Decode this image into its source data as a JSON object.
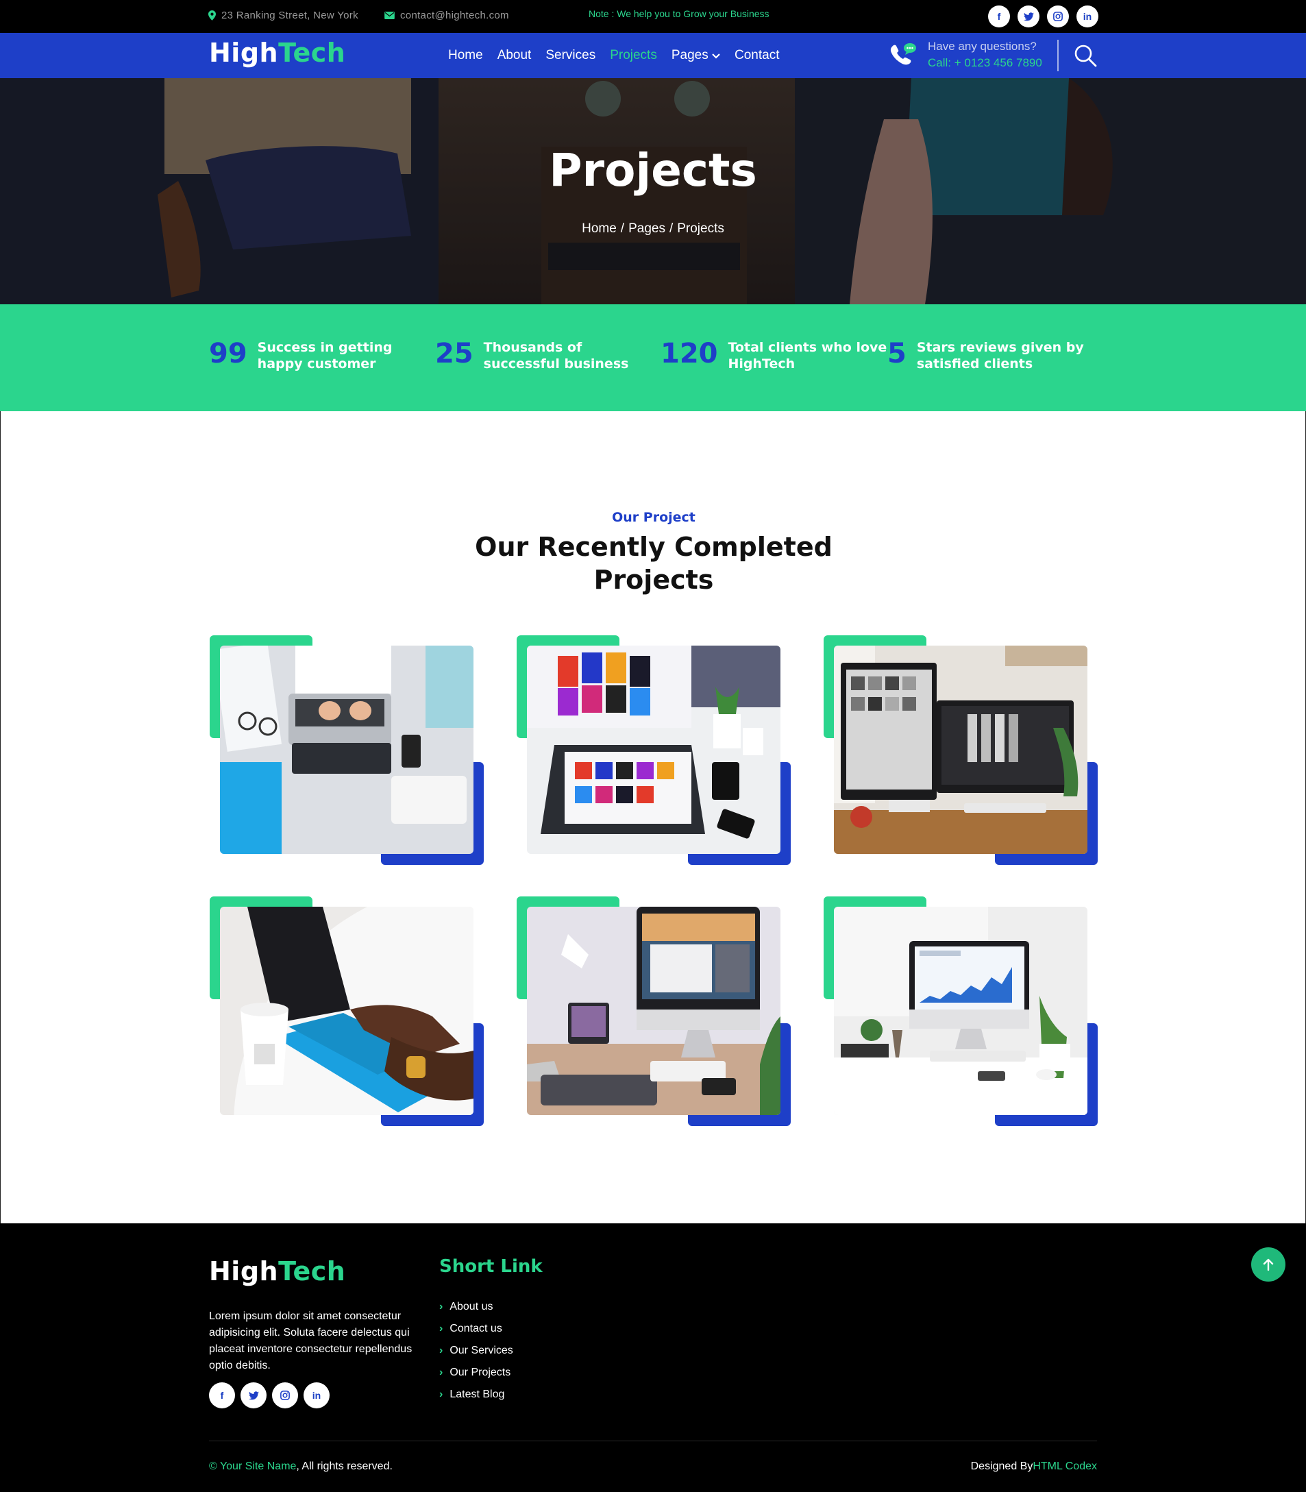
{
  "topbar": {
    "address": "23 Ranking Street, New York",
    "email": "contact@hightech.com",
    "note": "Note : We help you to Grow your Business",
    "socials": [
      "facebook-icon",
      "twitter-icon",
      "instagram-icon",
      "linkedin-icon"
    ]
  },
  "brand": {
    "part1": "High",
    "part2": "Tech"
  },
  "nav": {
    "items": [
      "Home",
      "About",
      "Services",
      "Projects",
      "Pages",
      "Contact"
    ],
    "active": "Projects",
    "question": "Have any questions?",
    "call": "Call: + 0123 456 7890"
  },
  "hero": {
    "title": "Projects",
    "breadcrumb": [
      "Home",
      "Pages",
      "Projects"
    ]
  },
  "stats": [
    {
      "number": "99",
      "text": "Success in getting happy customer"
    },
    {
      "number": "25",
      "text": "Thousands of successful business"
    },
    {
      "number": "120",
      "text": "Total clients who love HighTech"
    },
    {
      "number": "5",
      "text": "Stars reviews given by satisfied clients"
    }
  ],
  "projects": {
    "subtitle": "Our Project",
    "title": "Our Recently Completed Projects",
    "items": [
      "project-laptop-desk",
      "project-design-laptop",
      "project-dual-monitors",
      "project-tablet-typing",
      "project-imac-workspace",
      "project-analytics-imac"
    ]
  },
  "footer": {
    "about": "Lorem ipsum dolor sit amet consectetur adipisicing elit. Soluta facere delectus qui placeat inventore consectetur repellendus optio debitis.",
    "short_link_title": "Short Link",
    "links": [
      "About us",
      "Contact us",
      "Our Services",
      "Our Projects",
      "Latest Blog"
    ],
    "copyright_name": "Your Site Name",
    "copyright_rest": ", All rights reserved.",
    "designed_by": "Designed By",
    "designer": "HTML Codex"
  },
  "colors": {
    "green": "#2bd58d",
    "blue": "#1e3fc8",
    "black": "#000000"
  }
}
